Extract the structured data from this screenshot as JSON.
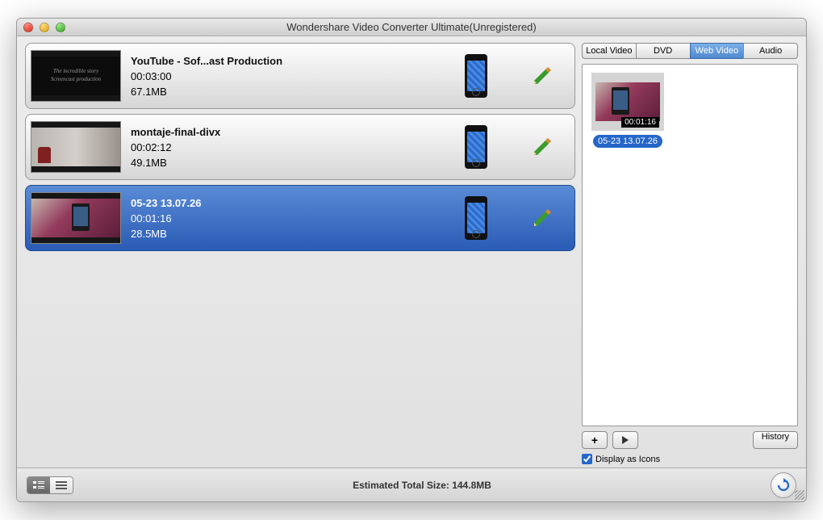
{
  "window": {
    "title": "Wondershare Video Converter Ultimate(Unregistered)"
  },
  "list": {
    "items": [
      {
        "title": "YouTube - Sof...ast Production",
        "duration": "00:03:00",
        "size": "67.1MB",
        "selected": false,
        "thumb": "dark"
      },
      {
        "title": "montaje-final-divx",
        "duration": "00:02:12",
        "size": "49.1MB",
        "selected": false,
        "thumb": "office"
      },
      {
        "title": "05-23 13.07.26",
        "duration": "00:01:16",
        "size": "28.5MB",
        "selected": true,
        "thumb": "phone"
      }
    ]
  },
  "tabs": {
    "items": [
      {
        "label": "Local Video",
        "active": false
      },
      {
        "label": "DVD",
        "active": false
      },
      {
        "label": "Web Video",
        "active": true
      },
      {
        "label": "Audio",
        "active": false
      }
    ]
  },
  "browser": {
    "file": {
      "label": "05-23 13.07.26",
      "time": "00:01:16"
    },
    "history_label": "History",
    "display_as_icons": "Display as Icons"
  },
  "footer": {
    "total": "Estimated Total Size: 144.8MB"
  }
}
